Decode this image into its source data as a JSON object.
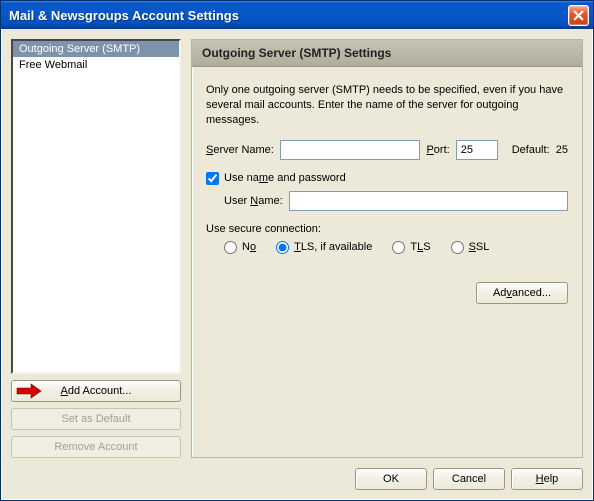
{
  "window": {
    "title": "Mail & Newsgroups Account Settings"
  },
  "tree": {
    "items": [
      {
        "label": "Outgoing Server (SMTP)",
        "selected": true
      },
      {
        "label": "Free Webmail",
        "selected": false
      }
    ]
  },
  "side_buttons": {
    "add": "Add Account...",
    "set_default": "Set as Default",
    "remove": "Remove Account"
  },
  "panel": {
    "heading": "Outgoing Server (SMTP) Settings",
    "intro": "Only one outgoing server (SMTP) needs to be specified, even if you have several mail accounts. Enter the name of the server for outgoing messages.",
    "server_name_label": "Server Name:",
    "server_name_value": "",
    "port_label": "Port:",
    "port_value": "25",
    "default_label": "Default:",
    "default_port": "25",
    "use_auth_label": "Use name and password",
    "use_auth_checked": true,
    "user_name_label": "User Name:",
    "user_name_value": "",
    "secure_label": "Use secure connection:",
    "secure_options": {
      "no": "No",
      "tls_avail": "TLS, if available",
      "tls": "TLS",
      "ssl": "SSL"
    },
    "secure_selected": "tls_avail",
    "advanced": "Advanced..."
  },
  "buttons": {
    "ok": "OK",
    "cancel": "Cancel",
    "help": "Help"
  }
}
